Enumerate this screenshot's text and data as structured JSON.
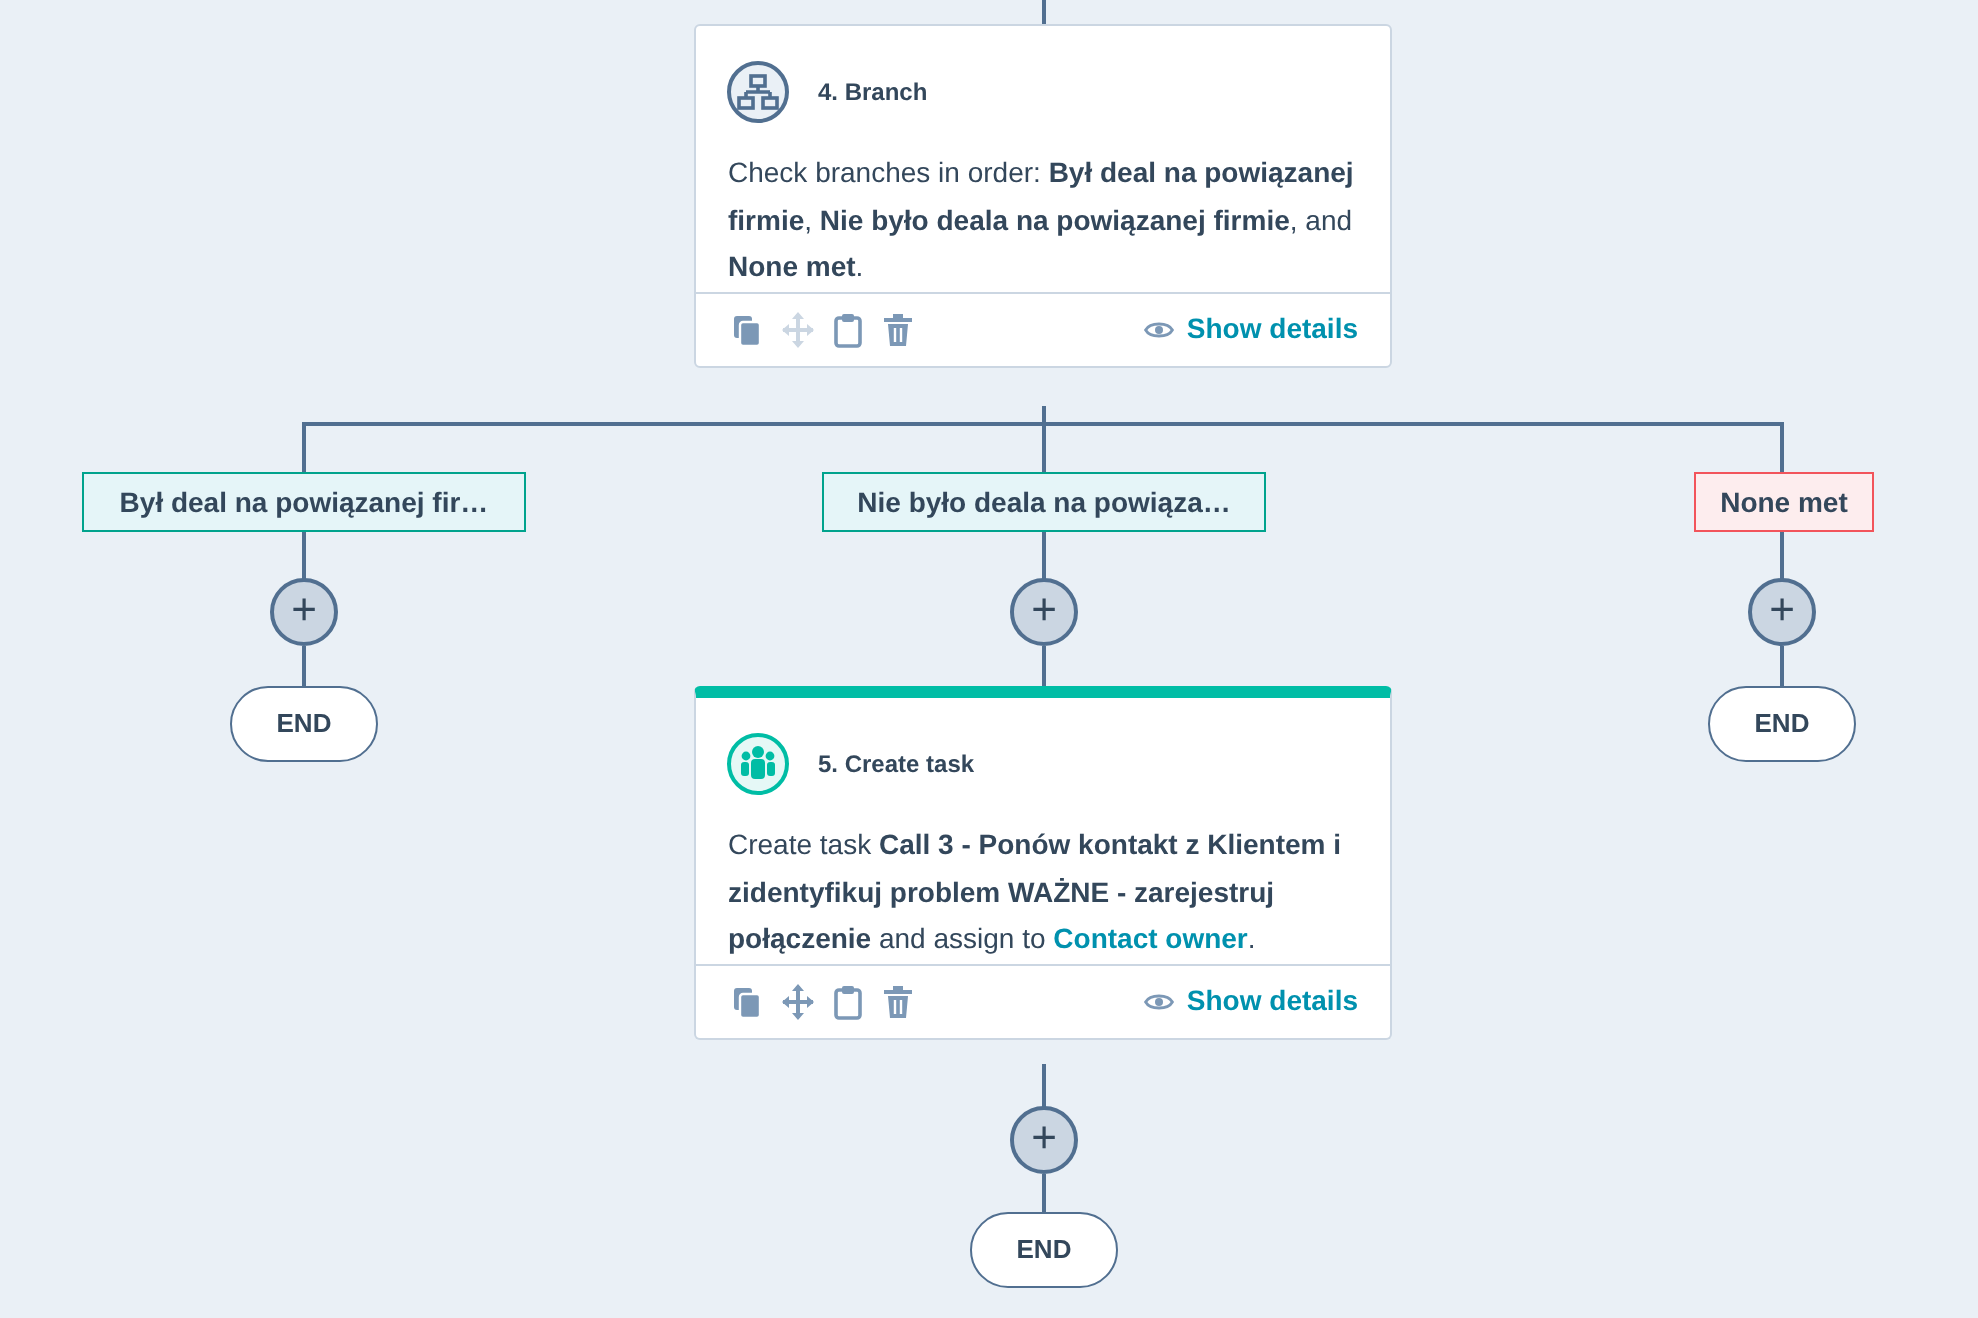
{
  "branch_step": {
    "kind": "branch",
    "title": "4. Branch",
    "description": [
      {
        "kind": "text",
        "text": "Check branches in order: **Był deal na powiązanej firmie**, **Nie było deala na powiązanej firmie**, and **None met**."
      }
    ],
    "actions": [
      {
        "kind": "copy",
        "disabled": false
      },
      {
        "kind": "move",
        "disabled": true
      },
      {
        "kind": "paste",
        "disabled": false
      },
      {
        "kind": "delete",
        "disabled": false
      }
    ],
    "details_link": "Show details"
  },
  "branches": [
    {
      "label": "Był deal na powiązanej fir…",
      "kind": "condition",
      "add_button": "+",
      "end": "END"
    },
    {
      "label": "Nie było deala na powiąza…",
      "kind": "condition",
      "add_button": "+",
      "step": {
        "kind": "task",
        "title": "5. Create task",
        "description": [
          {
            "kind": "text",
            "text": "Create task **Call 3 - Ponów kontakt z Klientem i zidentyfikuj problem WAŻNE - zarejestruj połączenie** and assign to "
          },
          {
            "kind": "link",
            "text": "Contact owner"
          },
          {
            "kind": "text",
            "text": "."
          }
        ],
        "actions": [
          {
            "kind": "copy",
            "disabled": false
          },
          {
            "kind": "move",
            "disabled": false
          },
          {
            "kind": "paste",
            "disabled": false
          },
          {
            "kind": "delete",
            "disabled": false
          }
        ],
        "details_link": "Show details"
      },
      "after": {
        "add_button": "+",
        "end": "END"
      }
    },
    {
      "label": "None met",
      "kind": "fallback",
      "add_button": "+",
      "end": "END"
    }
  ]
}
